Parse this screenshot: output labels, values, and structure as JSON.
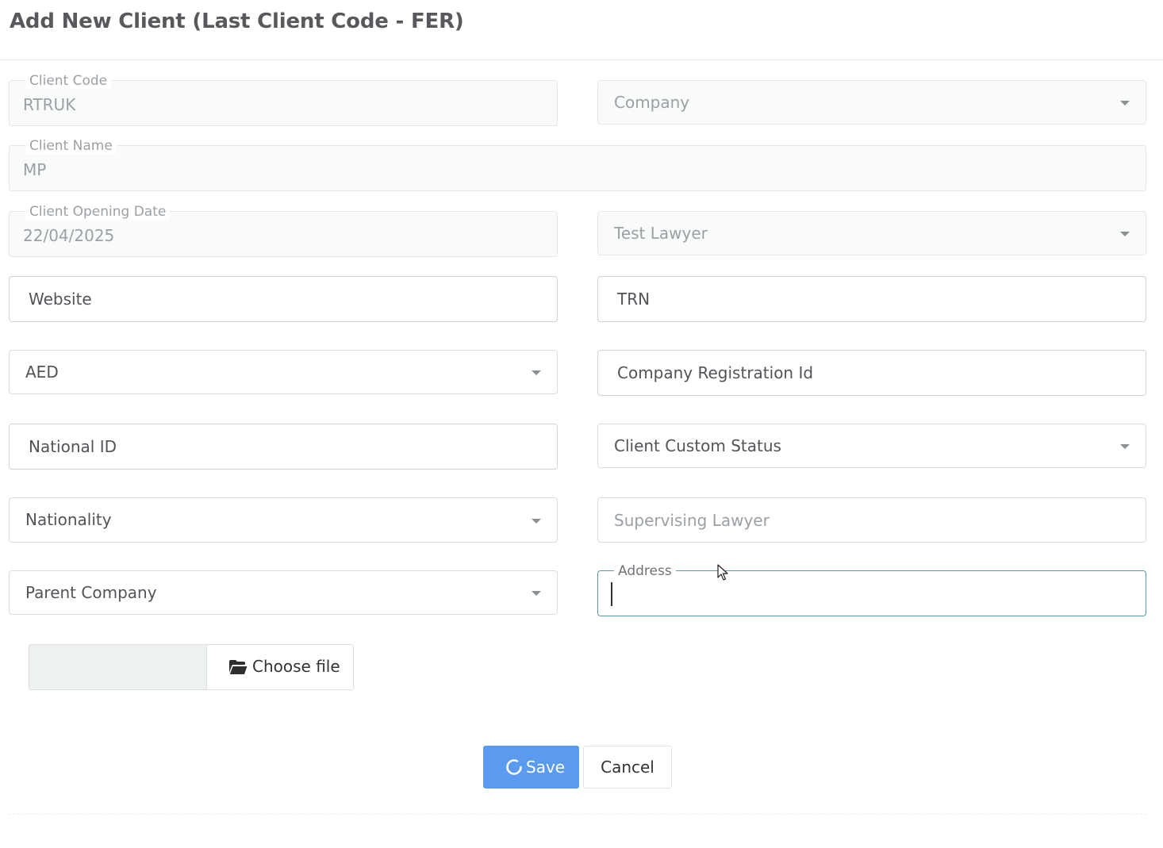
{
  "header": {
    "title": "Add New Client (Last Client Code - FER)"
  },
  "form": {
    "client_code": {
      "label": "Client Code",
      "value": "RTRUK"
    },
    "company": {
      "placeholder": "Company"
    },
    "client_name": {
      "label": "Client Name",
      "value": "MP"
    },
    "opening_date": {
      "label": "Client Opening Date",
      "value": "22/04/2025"
    },
    "lawyer": {
      "value": "Test Lawyer"
    },
    "website": {
      "placeholder": "Website"
    },
    "trn": {
      "placeholder": "TRN"
    },
    "currency": {
      "value": "AED"
    },
    "company_registration": {
      "placeholder": "Company Registration Id"
    },
    "national_id": {
      "placeholder": "National ID"
    },
    "custom_status": {
      "value": "Client Custom Status"
    },
    "nationality": {
      "value": "Nationality"
    },
    "supervising_lawyer": {
      "placeholder": "Supervising Lawyer"
    },
    "parent_company": {
      "value": "Parent Company"
    },
    "address": {
      "label": "Address",
      "value": ""
    },
    "file": {
      "button_label": "Choose file",
      "icon": "folder-open-icon"
    }
  },
  "actions": {
    "save_label": "Save",
    "save_icon": "spinner-icon",
    "cancel_label": "Cancel"
  },
  "colors": {
    "primary": "#5a9bef",
    "focus_border": "#5c9ba3",
    "border": "#d9dcdf",
    "muted_text": "#9aa0a5"
  }
}
